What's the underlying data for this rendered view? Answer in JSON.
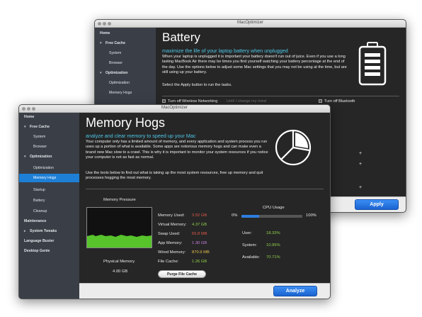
{
  "battery_window": {
    "title": "MacOptimizer",
    "sidebar": {
      "home": "Home",
      "free_cache": "Free Cache",
      "system": "System",
      "browser": "Browser",
      "optimization": "Optimization",
      "optimization_sub": "Optimization",
      "memory_hogs": "Memory Hogs"
    },
    "heading": "Battery",
    "subheading": "maximize the life of your laptop battery when unplugged",
    "description": "When your laptop is unplugged it is important your battery doesn't run out of juice. Even if you use a long lasting MacBook Air there may be times you find yourself watching your battery percentage at the end of the day. Use the options below to adjust some Mac settings that you may not be using at the time, but are still using up your battery.",
    "instruction": "Select the Apply button to run the tasks.",
    "options": {
      "wireless": "Turn off Wireless Networking",
      "wireless_hint": "Until I change my mind",
      "bluetooth": "Turn off Bluetooth"
    },
    "apply_label": "Apply"
  },
  "memory_window": {
    "title": "MacOptimizer",
    "sidebar": {
      "home": "Home",
      "free_cache": "Free Cache",
      "system": "System",
      "browser": "Browser",
      "optimization": "Optimization",
      "optimization_sub": "Optimization",
      "memory_hogs": "Memory Hogs",
      "startup": "Startup",
      "battery": "Battery",
      "cleanup": "Cleanup",
      "maintenance": "Maintenance",
      "system_tweaks": "System Tweaks",
      "language_buster": "Language Buster",
      "desktop_genie": "Desktop Genie"
    },
    "heading": "Memory Hogs",
    "subheading": "analyze and clear memory to speed up your Mac",
    "description": "Your computer only has a limited amount of memory, and every application and system process you run uses up a portion of what is available. Some apps are notorious memory hogs and can make even a brand new Mac slow to a crawl. This is why it is important to monitor your system resources if you notice your computer is not as fast as normal.",
    "instruction": "Use the tools below to find out what is taking up the most system resources, free up memory and quit processes hogging the most memory.",
    "memory_pressure_label": "Memory Pressure",
    "physical_memory_label": "Physical Memory",
    "physical_memory_value": "4.00 GB",
    "stats": [
      {
        "label": "Memory Used:",
        "value": "3.52 GB",
        "color": "#e0584a"
      },
      {
        "label": "Virtual Memory:",
        "value": "4.37 GB",
        "color": "#8fcf4a"
      },
      {
        "label": "Swap Used:",
        "value": "65.8 MB",
        "color": "#e0584a"
      },
      {
        "label": "App Memory:",
        "value": "1.30 GB",
        "color": "#c77ddf"
      },
      {
        "label": "Wired Memory:",
        "value": "870.9 MB",
        "color": "#e8c54a"
      },
      {
        "label": "File Cache:",
        "value": "1.26 GB",
        "color": "#8fcf4a"
      }
    ],
    "purge_label": "Purge File Cache",
    "cpu": {
      "title": "CPU Usage",
      "min_label": "0%",
      "max_label": "100%",
      "usage_fraction": 0.29,
      "rows": [
        {
          "label": "User:",
          "value": "18.33%"
        },
        {
          "label": "System:",
          "value": "10.95%"
        },
        {
          "label": "Available:",
          "value": "70.71%"
        }
      ]
    },
    "analyze_label": "Analyze"
  }
}
